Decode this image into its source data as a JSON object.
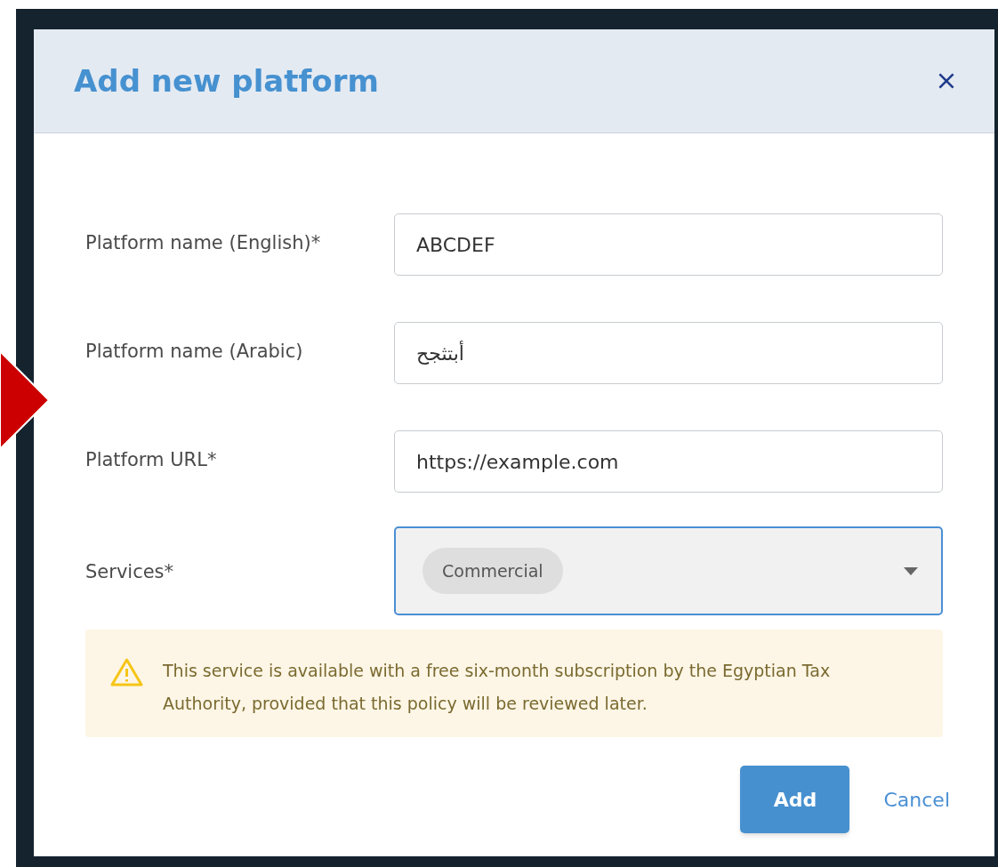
{
  "dialog": {
    "title": "Add new platform"
  },
  "fields": [
    {
      "kind": "text",
      "label": "Platform name (English)*",
      "value": "ABCDEF"
    },
    {
      "kind": "text",
      "label": "Platform name (Arabic)",
      "value": "أبتثجح"
    },
    {
      "kind": "text",
      "label": "Platform URL*",
      "value": "https://example.com"
    },
    {
      "kind": "select",
      "label": "Services*",
      "focused": true,
      "tags": [
        "Commercial"
      ]
    }
  ],
  "alert": {
    "text": "This service is available with a free six-month subscription by the Egyptian Tax Authority, provided that this policy will be reviewed later."
  },
  "buttons": [
    {
      "kind": "primary",
      "label": "Add"
    },
    {
      "kind": "link",
      "label": "Cancel"
    }
  ]
}
